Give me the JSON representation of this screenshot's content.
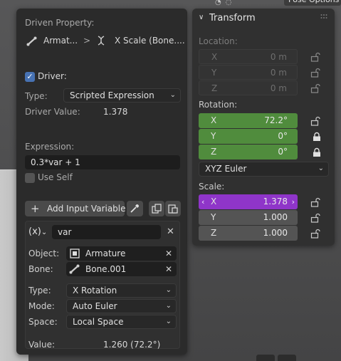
{
  "viewport": {
    "header_button_label": "Pose Options"
  },
  "driver_popup": {
    "driven_property_label": "Driven Property:",
    "breadcrumb": {
      "object": "Armat...",
      "separator": ">",
      "property": "X Scale (Bone...."
    },
    "driver_label": "Driver:",
    "driver_enabled": true,
    "type_label": "Type:",
    "type_value": "Scripted Expression",
    "driver_value_label": "Driver Value:",
    "driver_value": "1.378",
    "expression_label": "Expression:",
    "expression_value": "0.3*var + 1",
    "use_self_label": "Use Self",
    "use_self_checked": false,
    "add_variable_label": "Add Input Variable",
    "variable": {
      "type_symbol": "(x)",
      "name": "var",
      "object_label": "Object:",
      "object_value": "Armature",
      "bone_label": "Bone:",
      "bone_value": "Bone.001",
      "type_label": "Type:",
      "type_value": "X Rotation",
      "mode_label": "Mode:",
      "mode_value": "Auto Euler",
      "space_label": "Space:",
      "space_value": "Local Space",
      "value_label": "Value:",
      "value_value": "1.260 (72.2°)"
    }
  },
  "transform": {
    "title": "Transform",
    "location_label": "Location:",
    "location": [
      {
        "axis": "X",
        "value": "0 m"
      },
      {
        "axis": "Y",
        "value": "0 m"
      },
      {
        "axis": "Z",
        "value": "0 m"
      }
    ],
    "rotation_label": "Rotation:",
    "rotation": [
      {
        "axis": "X",
        "value": "72.2°"
      },
      {
        "axis": "Y",
        "value": "0°"
      },
      {
        "axis": "Z",
        "value": "0°"
      }
    ],
    "rotation_mode": "XYZ Euler",
    "scale_label": "Scale:",
    "scale": [
      {
        "axis": "X",
        "value": "1.378"
      },
      {
        "axis": "Y",
        "value": "1.000"
      },
      {
        "axis": "Z",
        "value": "1.000"
      }
    ]
  },
  "colors": {
    "driven_green": "#508c3d",
    "driver_purple": "#8f35c9",
    "checkbox_blue": "#4772b3",
    "panel_bg": "#2b2b2b"
  }
}
